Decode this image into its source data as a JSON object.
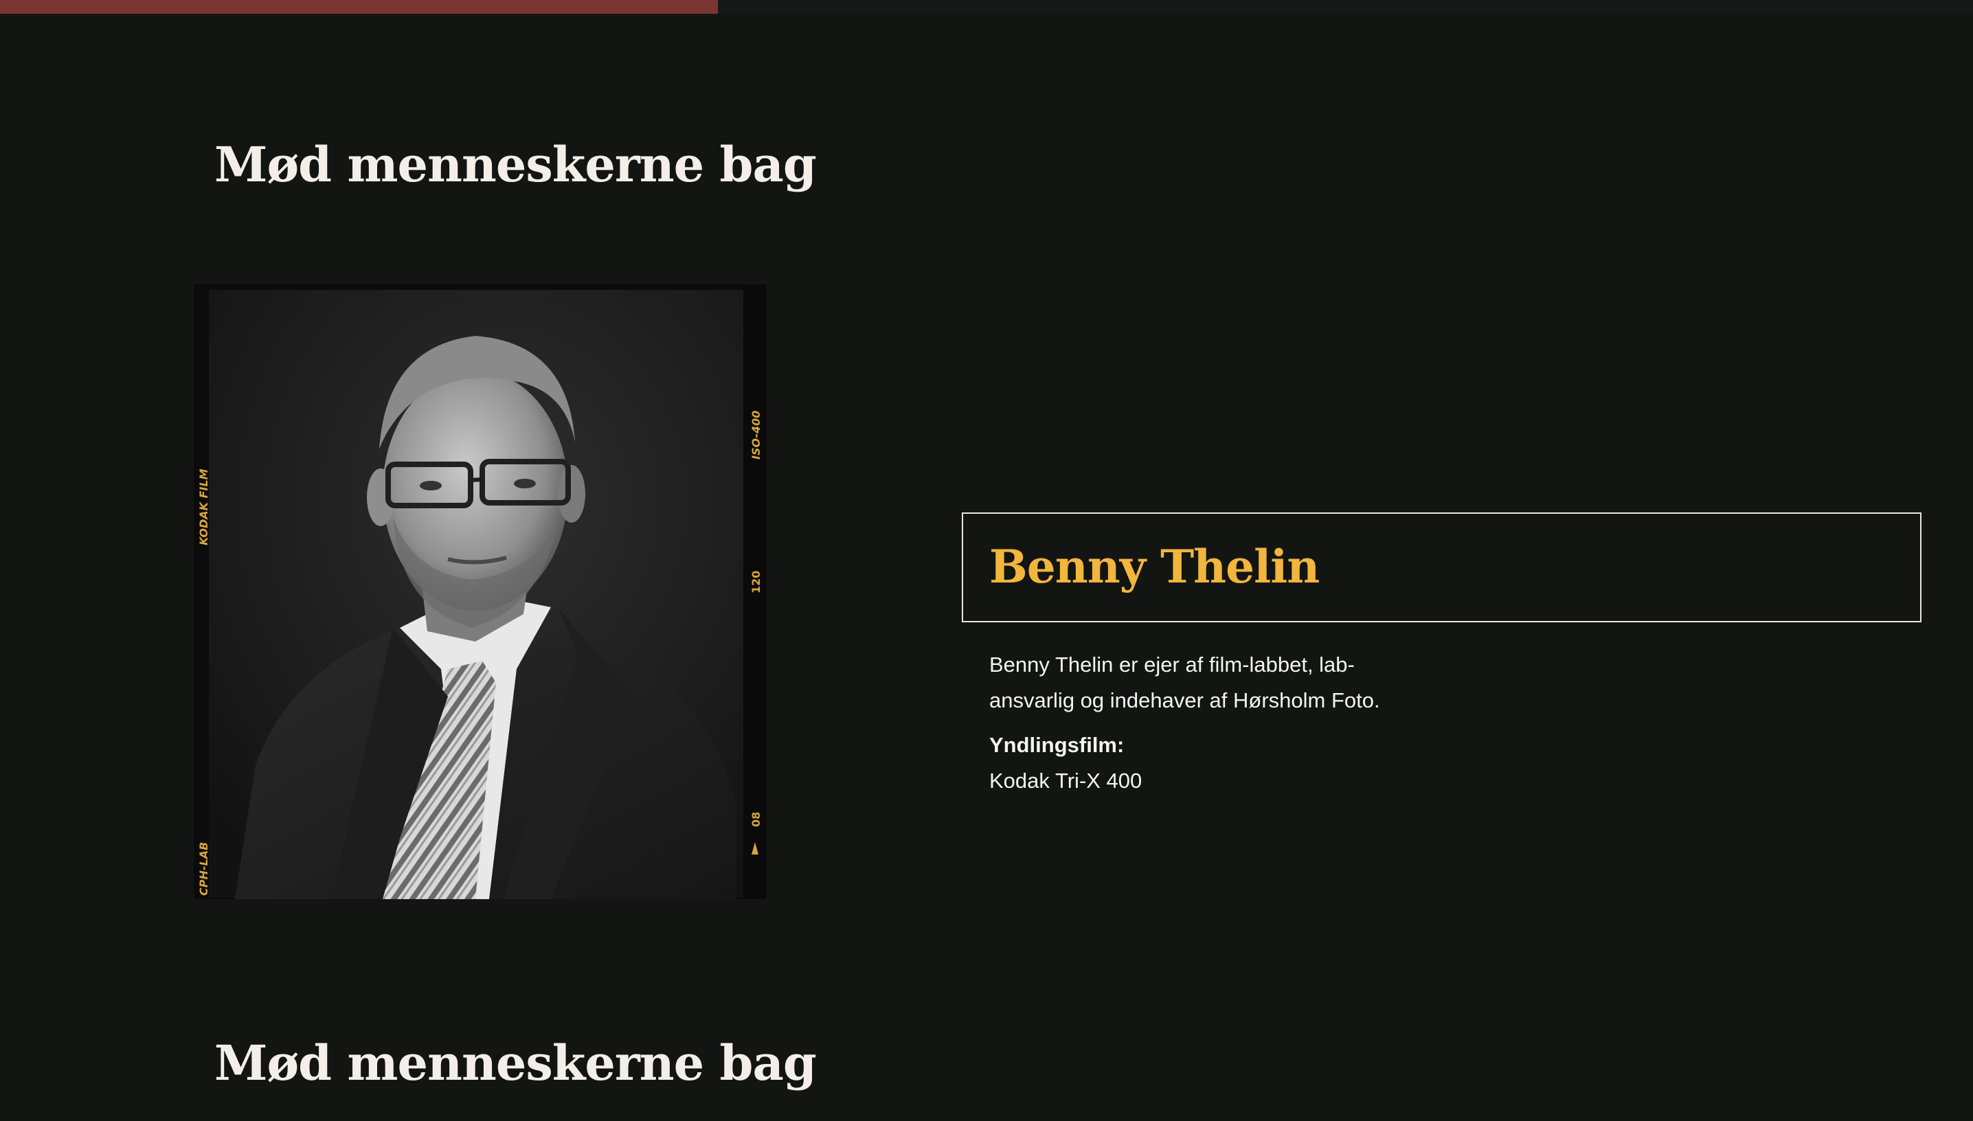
{
  "progress": {
    "fill_fraction": 0.364,
    "color": "#7a3431"
  },
  "section": {
    "heading": "Mød menneskerne bag",
    "next_heading": "Mød menneskerne bag"
  },
  "person": {
    "name": "Benny Thelin",
    "bio": "Benny Thelin er ejer af film-labbet, lab-ansvarlig og indehaver af Hørsholm Foto.",
    "favorite_label": "Yndlingsfilm:",
    "favorite_value": "Kodak Tri-X 400"
  },
  "photo": {
    "edge_left_top": "KODAK FILM",
    "edge_left_bottom": "CPH-LAB",
    "edge_right_top": "ISO-400",
    "edge_right_mid": "120",
    "edge_right_bottom": "08"
  },
  "colors": {
    "background": "#131513",
    "accent": "#f2b63d",
    "text": "#f4f4f2"
  }
}
